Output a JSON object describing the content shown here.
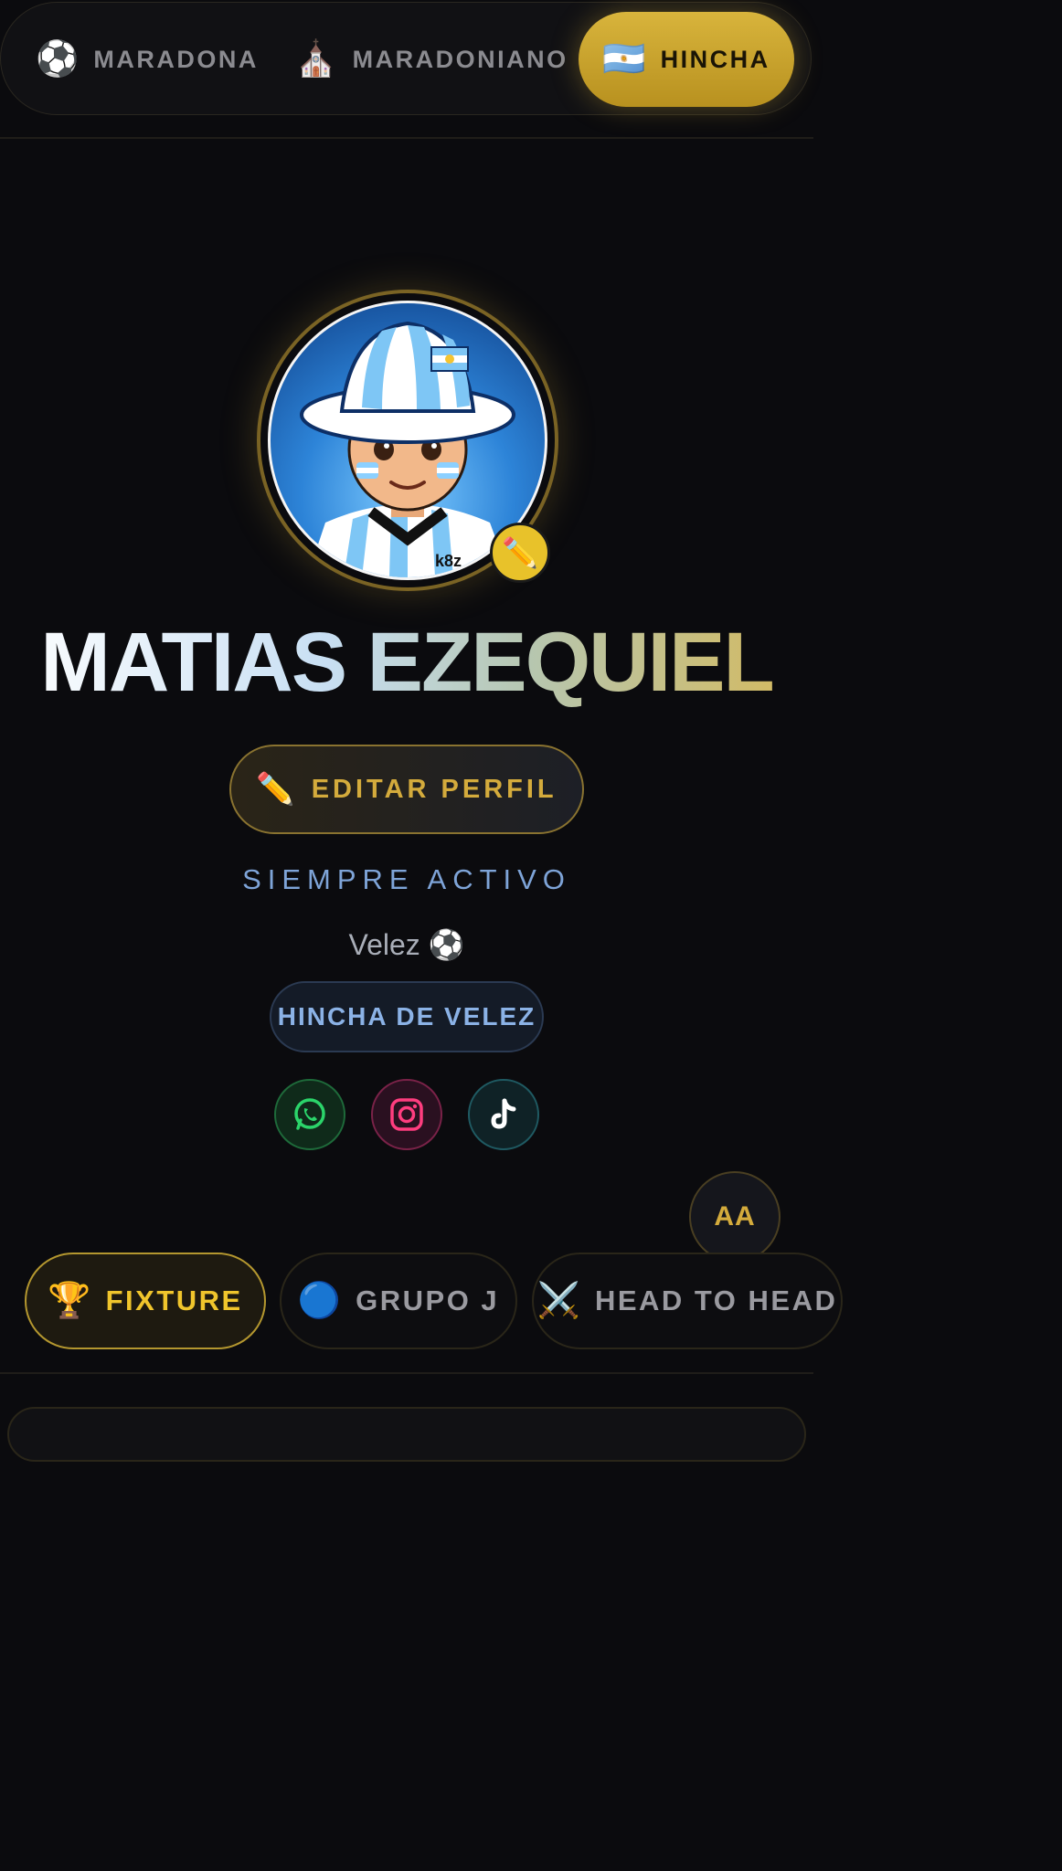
{
  "mode_switcher": {
    "items": [
      {
        "icon": "⚽",
        "icon_name": "soccer-ball-icon",
        "label": "MARADONA"
      },
      {
        "icon": "⛪",
        "icon_name": "church-icon",
        "label": "MARADONIANO"
      },
      {
        "icon": "🇦🇷",
        "icon_name": "argentina-flag-icon",
        "label": "HINCHA",
        "active": true
      }
    ]
  },
  "profile": {
    "avatar_tag": "k8z",
    "edit_avatar_icon": "✏️",
    "name": "MATIAS EZEQUIEL",
    "edit_button": {
      "icon": "✏️",
      "label": "EDITAR PERFIL"
    },
    "status": "SIEMPRE ACTIVO",
    "team_line": "Velez ⚽",
    "team_badge": "HINCHA DE VELEZ",
    "socials": [
      "whatsapp-icon",
      "instagram-icon",
      "tiktok-icon"
    ]
  },
  "font_size_button": "AA",
  "tabs": [
    {
      "icon": "🏆",
      "icon_name": "trophy-icon",
      "label": "FIXTURE",
      "active": true
    },
    {
      "icon": "🔵",
      "icon_name": "blue-circle-icon",
      "label": "GRUPO J"
    },
    {
      "icon": "⚔️",
      "icon_name": "crossed-swords-icon",
      "label": "HEAD TO HEAD"
    }
  ],
  "colors": {
    "background": "#0b0b0e",
    "accent_gold": "#d4ab3c",
    "status_blue": "#7ea4d8"
  }
}
